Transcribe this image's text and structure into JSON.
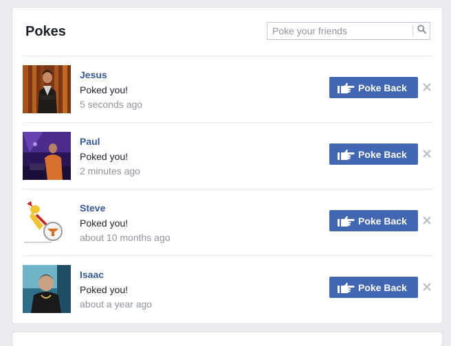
{
  "colors": {
    "accent": "#4267b2",
    "name_link": "#365899",
    "secondary_text": "#90949c",
    "close_icon": "#bec2c9"
  },
  "header": {
    "title": "Pokes",
    "search_placeholder": "Poke your friends",
    "search_icon": "search-icon"
  },
  "pokes": [
    {
      "name": "Jesus",
      "message": "Poked you!",
      "time": "5 seconds ago",
      "button_label": "Poke Back"
    },
    {
      "name": "Paul",
      "message": "Poked you!",
      "time": "2 minutes ago",
      "button_label": "Poke Back"
    },
    {
      "name": "Steve",
      "message": "Poked you!",
      "time": "about 10 months ago",
      "button_label": "Poke Back"
    },
    {
      "name": "Isaac",
      "message": "Poked you!",
      "time": "about a year ago",
      "button_label": "Poke Back"
    }
  ]
}
